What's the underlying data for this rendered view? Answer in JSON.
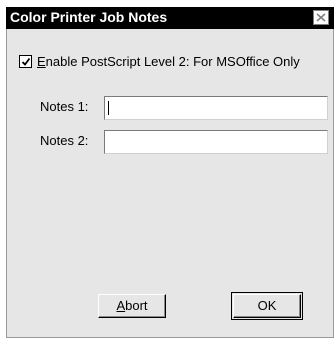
{
  "window": {
    "title": "Color Printer Job Notes"
  },
  "options": {
    "postscript_checkbox": {
      "mnemonic": "E",
      "label_rest": "nable PostScript Level 2: For MSOffice Only",
      "checked": true
    }
  },
  "fields": {
    "notes1": {
      "label": "Notes 1:",
      "value": ""
    },
    "notes2": {
      "label": "Notes 2:",
      "value": ""
    }
  },
  "buttons": {
    "abort": {
      "mnemonic": "A",
      "label_rest": "bort"
    },
    "ok": {
      "label": "OK"
    }
  },
  "icons": {
    "close": "close-icon",
    "check": "checkmark-icon"
  },
  "colors": {
    "titlebar_bg": "#000000",
    "titlebar_text": "#ffffff",
    "dialog_bg": "#e6e6e6"
  }
}
